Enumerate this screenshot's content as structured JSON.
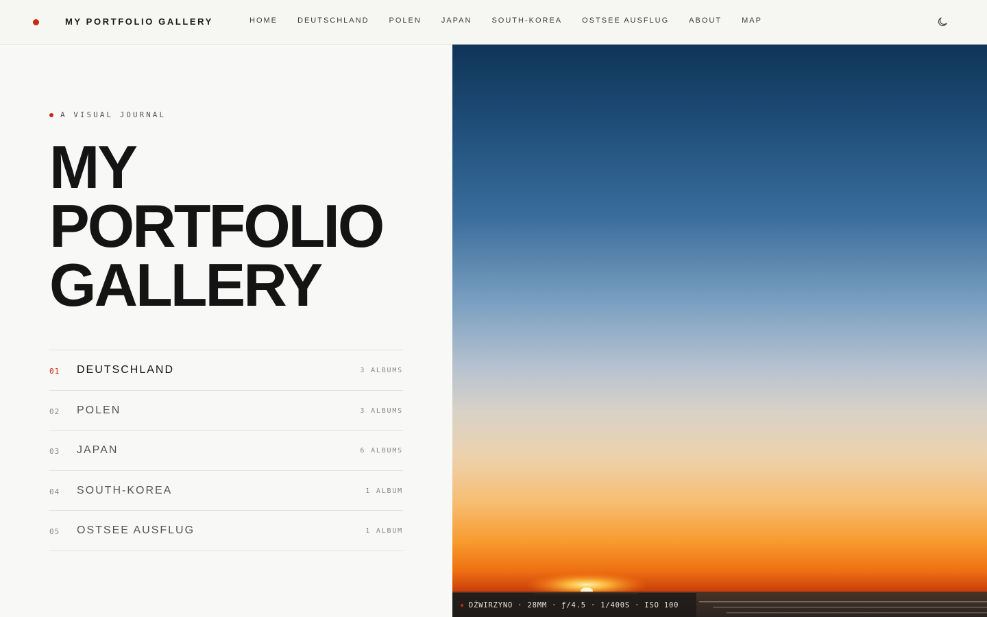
{
  "colors": {
    "accent": "#c62a12",
    "text": "#161616",
    "background": "#f8f8f6"
  },
  "header": {
    "brand": "MY PORTFOLIO GALLERY",
    "nav": [
      "HOME",
      "DEUTSCHLAND",
      "POLEN",
      "JAPAN",
      "SOUTH-KOREA",
      "OSTSEE AUSFLUG",
      "ABOUT",
      "MAP"
    ],
    "theme_icon": "moon-icon"
  },
  "hero": {
    "eyebrow": "A VISUAL JOURNAL",
    "title_lines": [
      "MY",
      "PORTFOLIO",
      "GALLERY"
    ]
  },
  "countries": [
    {
      "num": "01",
      "name": "DEUTSCHLAND",
      "count": "3 ALBUMS",
      "active": true
    },
    {
      "num": "02",
      "name": "POLEN",
      "count": "3 ALBUMS",
      "active": false
    },
    {
      "num": "03",
      "name": "JAPAN",
      "count": "6 ALBUMS",
      "active": false
    },
    {
      "num": "04",
      "name": "SOUTH-KOREA",
      "count": "1 ALBUM",
      "active": false
    },
    {
      "num": "05",
      "name": "OSTSEE AUSFLUG",
      "count": "1 ALBUM",
      "active": false
    }
  ],
  "photo": {
    "subject": "sunset over sea",
    "exif": "DŹWIRZYNO · 28MM · ƒ/4.5 · 1/400S · ISO 100"
  }
}
